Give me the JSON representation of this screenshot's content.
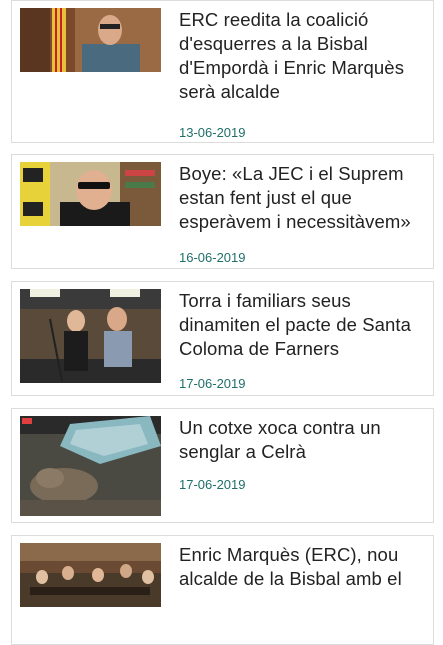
{
  "articles": [
    {
      "headline": "ERC reedita la coalició d'esquerres a la Bisbal d'Empordà i Enric Marquès serà alcalde",
      "date": "13-06-2019"
    },
    {
      "headline": "Boye: «La JEC i el Suprem estan fent just el que esperàvem i necessitàvem»",
      "date": "16-06-2019"
    },
    {
      "headline": "Torra i familiars seus dinamiten el pacte de Santa Coloma de Farners",
      "date": "17-06-2019"
    },
    {
      "headline": "Un cotxe xoca contra un senglar a Celrà",
      "date": "17-06-2019"
    },
    {
      "headline": "Enric Marquès (ERC), nou alcalde de la Bisbal amb el",
      "date": ""
    }
  ]
}
